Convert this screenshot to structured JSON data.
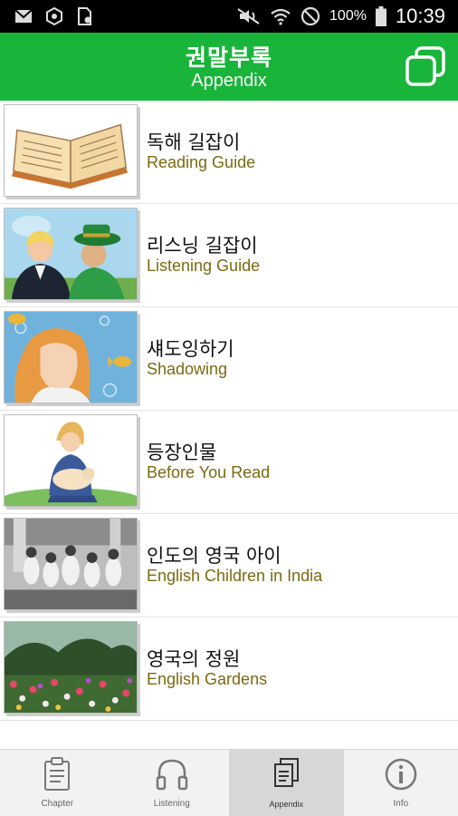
{
  "status_bar": {
    "icons_left": [
      "mail-icon",
      "network-icon",
      "sim-card-icon"
    ],
    "icons_right": [
      "mute-icon",
      "wifi-icon",
      "do-not-disturb-icon",
      "battery-icon"
    ],
    "battery_percent": "100%",
    "time": "10:39"
  },
  "header": {
    "title": "권말부록",
    "subtitle": "Appendix",
    "action_icon": "copy-pages-icon",
    "accent_color": "#18b53a"
  },
  "items": [
    {
      "title": "독해 길잡이",
      "subtitle": "Reading Guide",
      "image": "open-book-illustration"
    },
    {
      "title": "리스닝 길잡이",
      "subtitle": "Listening Guide",
      "image": "two-boys-illustration"
    },
    {
      "title": "섀도잉하기",
      "subtitle": "Shadowing",
      "image": "girl-with-fish-illustration"
    },
    {
      "title": "등장인물",
      "subtitle": "Before You Read",
      "image": "girl-with-lamb-illustration"
    },
    {
      "title": "인도의 영국 아이",
      "subtitle": "English Children in India",
      "image": "historical-photo"
    },
    {
      "title": "영국의 정원",
      "subtitle": "English Gardens",
      "image": "garden-photo"
    }
  ],
  "bottom_nav": [
    {
      "label": "Chapter",
      "icon": "clipboard-icon",
      "active": false
    },
    {
      "label": "Listening",
      "icon": "headphones-icon",
      "active": false
    },
    {
      "label": "Appendix",
      "icon": "pages-icon",
      "active": true
    },
    {
      "label": "Info",
      "icon": "info-icon",
      "active": false
    }
  ],
  "subtitle_color": "#7a6a12"
}
